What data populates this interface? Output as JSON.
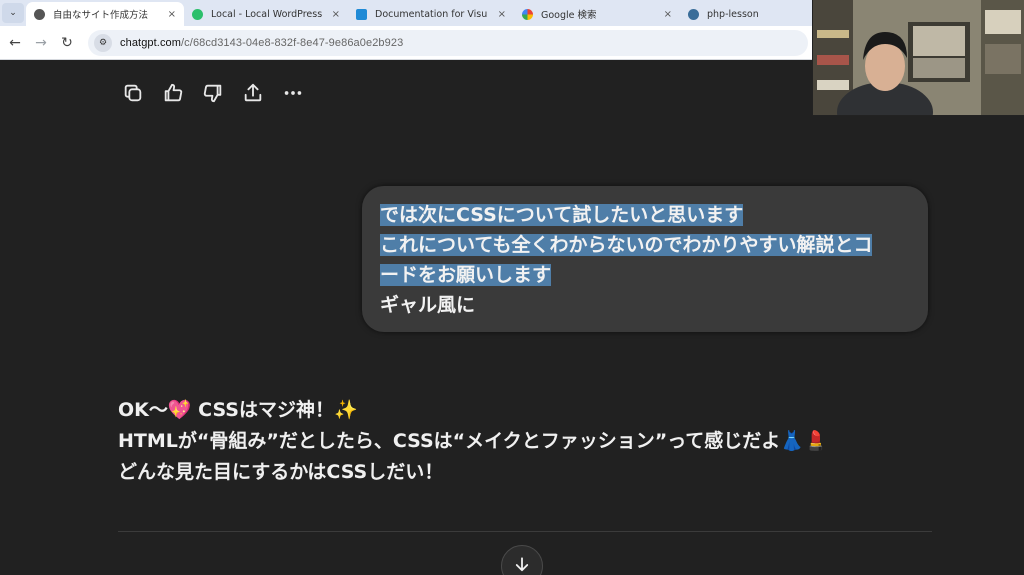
{
  "browser": {
    "tabs": [
      {
        "label": "自由なサイト作成方法",
        "active": true,
        "favicon": "gear-favicon-icon"
      },
      {
        "label": "Local - Local WordPress",
        "active": false,
        "favicon": "local-favicon-icon"
      },
      {
        "label": "Documentation for Visu",
        "active": false,
        "favicon": "vscode-favicon-icon"
      },
      {
        "label": "Google 検索",
        "active": false,
        "favicon": "google-favicon-icon"
      },
      {
        "label": "php-lesson",
        "active": false,
        "favicon": "wordpress-favicon-icon"
      }
    ],
    "close_glyph": "×",
    "url_host": "chatgpt.com",
    "url_path": "/c/68cd3143-04e8-832f-8e47-9e86a0e2b923"
  },
  "message_actions": [
    "copy-icon",
    "thumbs-up-icon",
    "thumbs-down-icon",
    "share-icon",
    "more-icon"
  ],
  "user_message": {
    "line1": "では次にCSSについて試したいと思います",
    "line2": "これについても全くわからないのでわかりやすい解説とコ",
    "line3": "ードをお願いします",
    "line4": "ギャル風に"
  },
  "assistant_message": {
    "line1": "OK〜💖 CSSはマジ神！✨",
    "line2": "HTMLが“骨組み”だとしたら、CSSは“メイクとファッション”って感じだよ👗💄",
    "line3": "どんな見た目にするかはCSSしだい！"
  },
  "colors": {
    "background": "#212121",
    "bubble": "#3a3a3a",
    "selection": "#4f7ea8",
    "tabstrip": "#dfe6f3"
  }
}
